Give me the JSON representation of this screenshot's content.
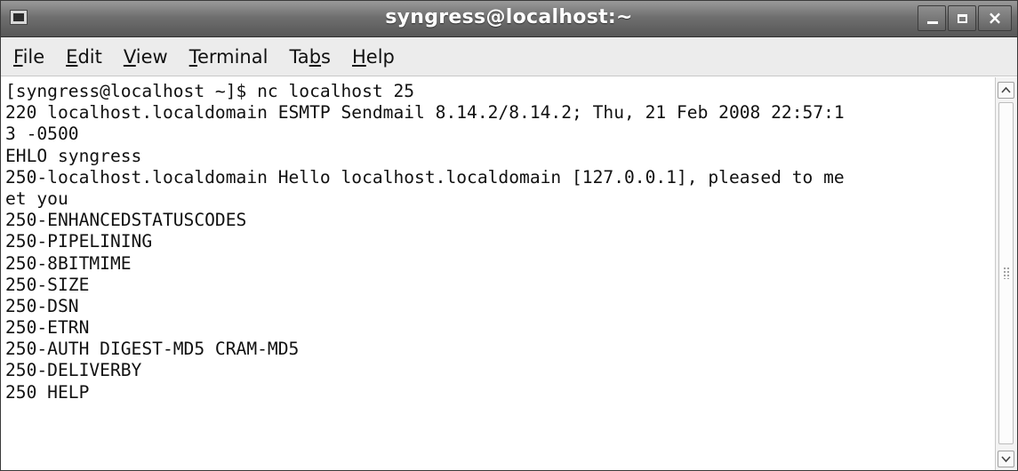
{
  "window": {
    "title": "syngress@localhost:~",
    "controls": {
      "close_label": "×"
    }
  },
  "menu": [
    {
      "pre": "",
      "key": "F",
      "post": "ile"
    },
    {
      "pre": "",
      "key": "E",
      "post": "dit"
    },
    {
      "pre": "",
      "key": "V",
      "post": "iew"
    },
    {
      "pre": "",
      "key": "T",
      "post": "erminal"
    },
    {
      "pre": "Ta",
      "key": "b",
      "post": "s"
    },
    {
      "pre": "",
      "key": "H",
      "post": "elp"
    }
  ],
  "terminal": {
    "lines": [
      "[syngress@localhost ~]$ nc localhost 25",
      "220 localhost.localdomain ESMTP Sendmail 8.14.2/8.14.2; Thu, 21 Feb 2008 22:57:1",
      "3 -0500",
      "EHLO syngress",
      "250-localhost.localdomain Hello localhost.localdomain [127.0.0.1], pleased to me",
      "et you",
      "250-ENHANCEDSTATUSCODES",
      "250-PIPELINING",
      "250-8BITMIME",
      "250-SIZE",
      "250-DSN",
      "250-ETRN",
      "250-AUTH DIGEST-MD5 CRAM-MD5",
      "250-DELIVERBY",
      "250 HELP"
    ]
  },
  "icons": {
    "app": "terminal-icon",
    "minimize": "minimize-icon",
    "maximize": "maximize-icon",
    "close": "close-icon",
    "scroll_up": "chevron-up-icon",
    "scroll_down": "chevron-down-icon"
  },
  "colors": {
    "titlebar": "#6f6f6f",
    "menubar": "#ececec",
    "terminal_bg": "#ffffff",
    "terminal_fg": "#111111"
  }
}
